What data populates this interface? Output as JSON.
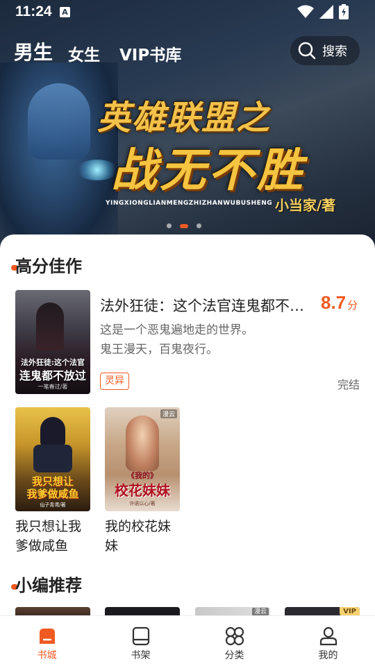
{
  "status_bar": {
    "time": "11:24",
    "notification_icon": "A"
  },
  "top_nav": {
    "tabs": [
      "男生",
      "女生",
      "VIP书库"
    ],
    "search_label": "搜索"
  },
  "banner": {
    "title_line1": "英雄联盟之",
    "title_line2": "战无不胜",
    "pinyin": "YINGXIONGLIANMENGZHIZHANWUBUSHENG",
    "author": "小当家/著",
    "dots_total": 3,
    "active_dot": 2
  },
  "section_high": {
    "title": "高分佳作",
    "featured": {
      "title": "法外狂徒：这个法官连鬼都不放过",
      "score": "8.7",
      "score_unit": "分",
      "desc_lines": [
        "这是一个恶鬼遍地走的世界。",
        "鬼王漫天，百鬼夜行。"
      ],
      "tag": "灵异",
      "status": "完结",
      "cover_text": [
        "法外狂徒:这个法官",
        "连鬼都不放过"
      ],
      "cover_author": "一笔春过/著"
    },
    "books": [
      {
        "title": "我只想让我爹做咸鱼",
        "title_lines": [
          "我只想让我",
          "爹做咸鱼"
        ],
        "cover_text": [
          "我只想让",
          "我爹做咸鱼"
        ],
        "cover_author": "仙子青鸢/著"
      },
      {
        "title": "我的校花妹妹",
        "title_lines": [
          "我的校花妹",
          "妹"
        ],
        "cover_text": [
          "《我的》",
          "校花妹妹"
        ],
        "cover_author": "许诺以心/著",
        "badge": "漫云"
      }
    ]
  },
  "section_recommend": {
    "title": "小编推荐",
    "badges": [
      "漫云",
      "VIP"
    ]
  },
  "bottom_nav": [
    {
      "label": "书城",
      "icon": "bookstore-icon",
      "active": true
    },
    {
      "label": "书架",
      "icon": "bookshelf-icon",
      "active": false
    },
    {
      "label": "分类",
      "icon": "category-icon",
      "active": false
    },
    {
      "label": "我的",
      "icon": "profile-icon",
      "active": false
    }
  ],
  "colors": {
    "accent": "#f05a22",
    "banner_gold": "#f5c440"
  }
}
